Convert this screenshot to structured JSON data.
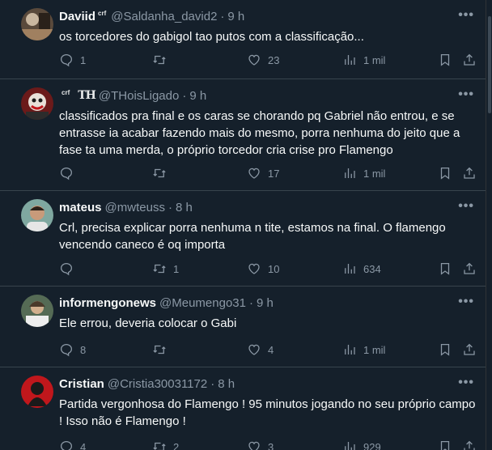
{
  "tweets": [
    {
      "name": "Daviid",
      "badge": "crf",
      "handle": "@Saldanha_david2",
      "time": "9 h",
      "text": "os torcedores do gabigol tao putos com a classificação...",
      "replies": "1",
      "retweets": "",
      "likes": "23",
      "views": "1 mil"
    },
    {
      "name": "",
      "badge": "crf",
      "badge2": "TH",
      "handle": "@THoisLigado",
      "time": "9 h",
      "text": "classificados pra final e os caras se chorando pq Gabriel não entrou, e se entrasse ia acabar fazendo mais do mesmo, porra nenhuma do jeito que a fase ta uma merda, o próprio torcedor cria crise pro Flamengo",
      "replies": "",
      "retweets": "",
      "likes": "17",
      "views": "1 mil"
    },
    {
      "name": "mateus",
      "handle": "@mwteuss",
      "time": "8 h",
      "text": "Crl, precisa explicar porra nenhuma n tite, estamos na final. O flamengo vencendo caneco é oq importa",
      "replies": "",
      "retweets": "1",
      "likes": "10",
      "views": "634"
    },
    {
      "name": "informengonews",
      "handle": "@Meumengo31",
      "time": "9 h",
      "text": "Ele errou, deveria colocar o Gabi",
      "replies": "8",
      "retweets": "",
      "likes": "4",
      "views": "1 mil"
    },
    {
      "name": "Cristian",
      "handle": "@Cristia30031172",
      "time": "8 h",
      "text": "Partida vergonhosa do Flamengo ! 95 minutos jogando no seu próprio campo ! Isso não é Flamengo !",
      "replies": "4",
      "retweets": "2",
      "likes": "3",
      "views": "929"
    }
  ],
  "separator": "·",
  "more_glyph": "•••",
  "icons": [
    "reply-icon",
    "retweet-icon",
    "like-icon",
    "views-icon",
    "bookmark-icon",
    "share-icon",
    "more-icon"
  ],
  "colors": {
    "background": "#15202b",
    "text": "#f7f9f9",
    "muted": "#8b98a5",
    "border": "#38444d"
  }
}
